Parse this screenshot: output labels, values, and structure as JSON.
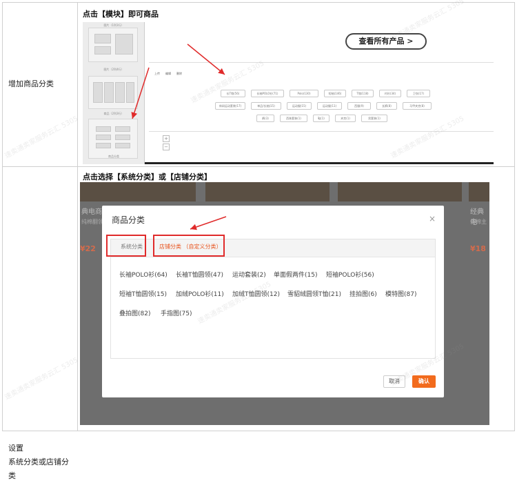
{
  "rows": [
    {
      "label": "增加商品分类",
      "step": "点击【模块】即可商品"
    },
    {
      "label": "设置\n系统分类或店铺分类",
      "label_lines": [
        "设置",
        "系统分类或店铺分",
        "类"
      ],
      "step": "点击选择【系统分类】或【店铺分类】"
    }
  ],
  "shot1": {
    "all_products_button": "查看所有产品 >",
    "palette_captions": [
      "图片（1列1行）",
      "图片（2列4行）",
      "商品（2列3行）",
      "商品分类"
    ],
    "tools": [
      "上传",
      "编辑",
      "删除"
    ],
    "chips_row1": [
      "长T恤(56)",
      "长袖POLO衫(71)",
      "Polo(130)",
      "短袖(146)",
      "T恤(118)",
      "衬衫(34)",
      "卫衣(17)"
    ],
    "chips_row2": [
      "休闲运动套装(17)",
      "单品/长袖(15)",
      "运动服(15)",
      "运动服(11)",
      "西服(9)",
      "长裤(8)",
      "马甲夹克(8)"
    ],
    "chips_row3": [
      "裤(3)",
      "西装套装(1)",
      "鞋(1)",
      "夹克(1)",
      "男套装(1)"
    ],
    "zoom": [
      "+",
      "−"
    ]
  },
  "shot2": {
    "product_left": {
      "name": "典电商",
      "desc": "纯棉翻领",
      "price": "¥22"
    },
    "product_right": {
      "name": "经典电",
      "desc": "仿棉主",
      "price": "¥18"
    },
    "modal": {
      "title": "商品分类",
      "close": "×",
      "tab_system": "系统分类",
      "tab_shop": "店铺分类 （自定义分类）",
      "categories_row1": [
        "长袖POLO衫(64)",
        "长袖T恤圆领(47)",
        "运动套装(2)",
        "单面假两件(15)",
        "短袖POLO衫(56)"
      ],
      "categories_row2": [
        "短袖T恤圆领(15)",
        "加绒POLO衫(11)",
        "加绒T恤圆领(12)",
        "雪貂绒圆领T恤(21)",
        "挂拍图(6)",
        "模特图(87)"
      ],
      "categories_row3": [
        "叠拍图(82)",
        "手指图(75)"
      ],
      "cancel": "取消",
      "confirm": "确认"
    }
  },
  "colors": {
    "accent": "#f26b1d",
    "highlight": "#e02a2a"
  },
  "watermark": "速卖通卖家服务云汇 5305"
}
